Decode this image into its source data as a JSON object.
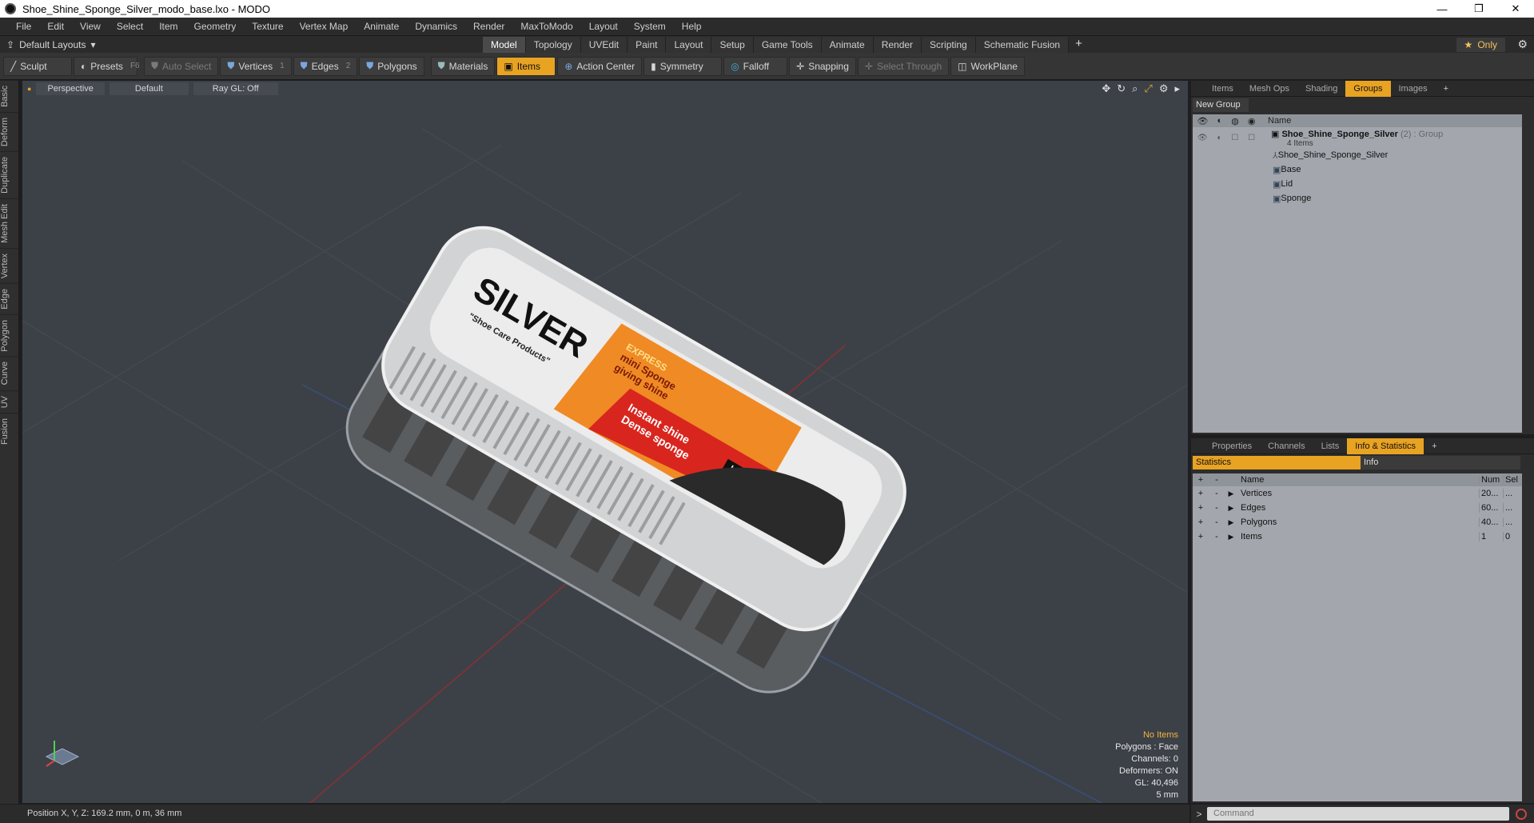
{
  "window": {
    "title": "Shoe_Shine_Sponge_Silver_modo_base.lxo - MODO",
    "minimize": "—",
    "maximize": "❐",
    "close": "✕"
  },
  "menu": [
    "File",
    "Edit",
    "View",
    "Select",
    "Item",
    "Geometry",
    "Texture",
    "Vertex Map",
    "Animate",
    "Dynamics",
    "Render",
    "MaxToModo",
    "Layout",
    "System",
    "Help"
  ],
  "layout": {
    "selector": "Default Layouts",
    "tabs": [
      "Model",
      "Topology",
      "UVEdit",
      "Paint",
      "Layout",
      "Setup",
      "Game Tools",
      "Animate",
      "Render",
      "Scripting",
      "Schematic Fusion"
    ],
    "active_tab": "Model",
    "only": "Only"
  },
  "toolbar": {
    "sculpt": "Sculpt",
    "presets": "Presets",
    "presets_key": "F6",
    "auto_select": "Auto Select",
    "vertices": "Vertices",
    "vertices_key": "1",
    "edges": "Edges",
    "edges_key": "2",
    "polygons": "Polygons",
    "materials": "Materials",
    "items": "Items",
    "action_center": "Action Center",
    "symmetry": "Symmetry",
    "falloff": "Falloff",
    "snapping": "Snapping",
    "select_through": "Select Through",
    "workplane": "WorkPlane"
  },
  "left_tabs": [
    "Basic",
    "Deform",
    "Duplicate",
    "Mesh Edit",
    "Vertex",
    "Edge",
    "Polygon",
    "Curve",
    "UV",
    "Fusion"
  ],
  "viewport": {
    "view": "Perspective",
    "shading": "Default",
    "raygl": "Ray GL: Off",
    "info": {
      "no_items": "No Items",
      "polygons": "Polygons : Face",
      "channels": "Channels: 0",
      "deformers": "Deformers: ON",
      "gl": "GL: 40,496",
      "scale": "5 mm"
    },
    "label": {
      "brand": "SILVER",
      "tagline": "\"Shoe Care Products\"",
      "express": "EXPRESS",
      "line1": "mini Sponge",
      "line2": "giving shine",
      "line3": "Instant shine",
      "line4": "Dense sponge",
      "color": "black"
    }
  },
  "groups_panel": {
    "tabs": [
      "Items",
      "Mesh Ops",
      "Shading",
      "Groups",
      "Images"
    ],
    "active_tab": "Groups",
    "new_group": "New Group",
    "header_name": "Name",
    "group_name": "Shoe_Shine_Sponge_Silver",
    "group_suffix": "(2) : Group",
    "group_count": "4 Items",
    "children": [
      "Shoe_Shine_Sponge_Silver",
      "Base",
      "Lid",
      "Sponge"
    ]
  },
  "stats_panel": {
    "tabs": [
      "Properties",
      "Channels",
      "Lists",
      "Info & Statistics"
    ],
    "active_tab": "Info & Statistics",
    "sub_statistics": "Statistics",
    "sub_info": "Info",
    "headers": {
      "name": "Name",
      "num": "Num",
      "sel": "Sel"
    },
    "rows": [
      {
        "name": "Vertices",
        "num": "20...",
        "sel": "..."
      },
      {
        "name": "Edges",
        "num": "60...",
        "sel": "..."
      },
      {
        "name": "Polygons",
        "num": "40...",
        "sel": "..."
      },
      {
        "name": "Items",
        "num": "1",
        "sel": "0"
      }
    ]
  },
  "command": {
    "placeholder": "Command"
  },
  "status": {
    "position": "Position X, Y, Z:  169.2 mm, 0 m, 36 mm"
  }
}
